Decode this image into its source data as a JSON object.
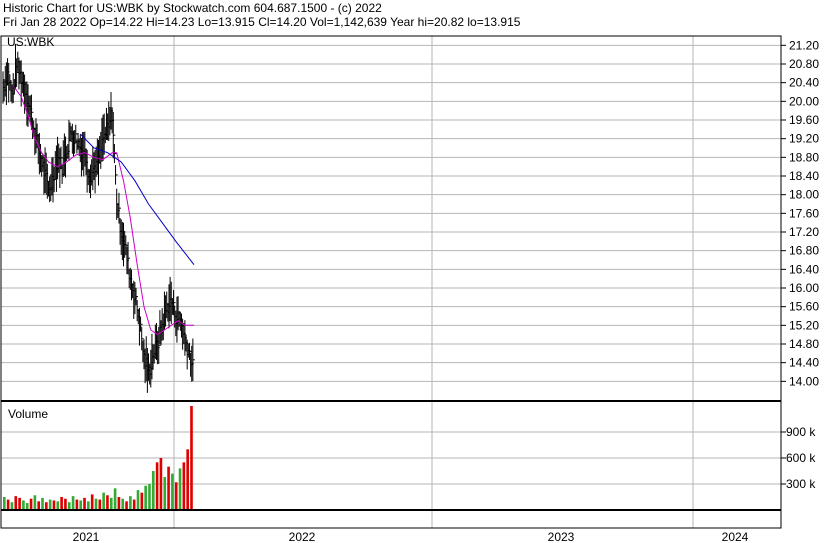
{
  "header": {
    "line1": "Historic Chart for US:WBK by Stockwatch.com 604.687.1500 - (c) 2022",
    "line2": "Fri Jan 28 2022   Op=14.22   Hi=14.23   Lo=13.915   Cl=14.20   Vol=1,142,639   Year hi=20.82   lo=13.915"
  },
  "colors": {
    "ma_fast": "#cc00cc",
    "ma_slow": "#0000cc",
    "vol_up": "#33aa33",
    "vol_down": "#dd0000",
    "grid": "#b4b4b4",
    "bars": "#000000"
  },
  "chart_data": [
    {
      "type": "ohlc-line",
      "label": "US:WBK",
      "ylim": [
        13.6,
        21.4
      ],
      "ytick_labels": [
        "21.20",
        "20.80",
        "20.40",
        "20.00",
        "19.60",
        "19.20",
        "18.80",
        "18.40",
        "18.00",
        "17.60",
        "17.20",
        "16.80",
        "16.40",
        "16.00",
        "15.60",
        "15.20",
        "14.80",
        "14.40",
        "14.00"
      ],
      "ytick_values": [
        21.2,
        20.8,
        20.4,
        20.0,
        19.6,
        19.2,
        18.8,
        18.4,
        18.0,
        17.6,
        17.2,
        16.8,
        16.4,
        16.0,
        15.6,
        15.2,
        14.8,
        14.4,
        14.0
      ],
      "xtick_labels": [
        "2021",
        "2022",
        "2023",
        "2024"
      ],
      "price_points": [
        {
          "x": 0.0,
          "y": 20.3
        },
        {
          "x": 0.02,
          "y": 20.6
        },
        {
          "x": 0.04,
          "y": 20.1
        },
        {
          "x": 0.06,
          "y": 20.75
        },
        {
          "x": 0.08,
          "y": 20.5
        },
        {
          "x": 0.1,
          "y": 20.2
        },
        {
          "x": 0.12,
          "y": 19.8
        },
        {
          "x": 0.14,
          "y": 19.3
        },
        {
          "x": 0.16,
          "y": 18.9
        },
        {
          "x": 0.18,
          "y": 18.5
        },
        {
          "x": 0.2,
          "y": 18.1
        },
        {
          "x": 0.22,
          "y": 18.4
        },
        {
          "x": 0.24,
          "y": 18.8
        },
        {
          "x": 0.26,
          "y": 18.6
        },
        {
          "x": 0.28,
          "y": 19.0
        },
        {
          "x": 0.3,
          "y": 19.3
        },
        {
          "x": 0.32,
          "y": 19.2
        },
        {
          "x": 0.34,
          "y": 19.0
        },
        {
          "x": 0.36,
          "y": 18.9
        },
        {
          "x": 0.38,
          "y": 18.4
        },
        {
          "x": 0.4,
          "y": 18.6
        },
        {
          "x": 0.42,
          "y": 18.7
        },
        {
          "x": 0.44,
          "y": 19.2
        },
        {
          "x": 0.46,
          "y": 19.4
        },
        {
          "x": 0.48,
          "y": 19.75
        },
        {
          "x": 0.5,
          "y": 17.9
        },
        {
          "x": 0.52,
          "y": 17.2
        },
        {
          "x": 0.54,
          "y": 16.8
        },
        {
          "x": 0.56,
          "y": 16.2
        },
        {
          "x": 0.58,
          "y": 15.8
        },
        {
          "x": 0.6,
          "y": 15.3
        },
        {
          "x": 0.62,
          "y": 14.5
        },
        {
          "x": 0.64,
          "y": 14.2
        },
        {
          "x": 0.66,
          "y": 14.6
        },
        {
          "x": 0.68,
          "y": 14.8
        },
        {
          "x": 0.7,
          "y": 15.2
        },
        {
          "x": 0.72,
          "y": 15.6
        },
        {
          "x": 0.74,
          "y": 15.7
        },
        {
          "x": 0.76,
          "y": 15.4
        },
        {
          "x": 0.78,
          "y": 15.3
        },
        {
          "x": 0.8,
          "y": 14.9
        },
        {
          "x": 0.82,
          "y": 14.6
        },
        {
          "x": 0.84,
          "y": 14.2
        }
      ],
      "ma_fast": [
        {
          "x": 0.05,
          "y": 20.3
        },
        {
          "x": 0.08,
          "y": 20.1
        },
        {
          "x": 0.11,
          "y": 19.7
        },
        {
          "x": 0.14,
          "y": 19.2
        },
        {
          "x": 0.17,
          "y": 18.9
        },
        {
          "x": 0.2,
          "y": 18.7
        },
        {
          "x": 0.24,
          "y": 18.6
        },
        {
          "x": 0.28,
          "y": 18.7
        },
        {
          "x": 0.32,
          "y": 18.85
        },
        {
          "x": 0.36,
          "y": 18.9
        },
        {
          "x": 0.4,
          "y": 18.8
        },
        {
          "x": 0.44,
          "y": 18.75
        },
        {
          "x": 0.48,
          "y": 18.9
        },
        {
          "x": 0.5,
          "y": 18.9
        },
        {
          "x": 0.53,
          "y": 18.3
        },
        {
          "x": 0.56,
          "y": 17.5
        },
        {
          "x": 0.59,
          "y": 16.5
        },
        {
          "x": 0.62,
          "y": 15.6
        },
        {
          "x": 0.65,
          "y": 15.1
        },
        {
          "x": 0.68,
          "y": 15.0
        },
        {
          "x": 0.71,
          "y": 15.1
        },
        {
          "x": 0.74,
          "y": 15.2
        },
        {
          "x": 0.77,
          "y": 15.3
        },
        {
          "x": 0.8,
          "y": 15.2
        },
        {
          "x": 0.84,
          "y": 15.2
        }
      ],
      "ma_slow": [
        {
          "x": 0.34,
          "y": 19.3
        },
        {
          "x": 0.4,
          "y": 19.0
        },
        {
          "x": 0.46,
          "y": 18.9
        },
        {
          "x": 0.52,
          "y": 18.7
        },
        {
          "x": 0.58,
          "y": 18.3
        },
        {
          "x": 0.64,
          "y": 17.8
        },
        {
          "x": 0.7,
          "y": 17.4
        },
        {
          "x": 0.76,
          "y": 17.0
        },
        {
          "x": 0.84,
          "y": 16.5
        }
      ]
    },
    {
      "type": "bar",
      "label": "Volume",
      "ylim": [
        0,
        1200000
      ],
      "ytick_labels": [
        "900 k",
        "600 k",
        "300 k"
      ],
      "ytick_values": [
        900000,
        600000,
        300000
      ],
      "values": [
        150000,
        120000,
        90000,
        160000,
        140000,
        110000,
        80000,
        130000,
        170000,
        100000,
        140000,
        90000,
        120000,
        110000,
        100000,
        150000,
        130000,
        90000,
        160000,
        120000,
        110000,
        140000,
        100000,
        180000,
        130000,
        120000,
        200000,
        170000,
        140000,
        250000,
        150000,
        130000,
        100000,
        160000,
        120000,
        230000,
        200000,
        280000,
        300000,
        450000,
        550000,
        600000,
        380000,
        500000,
        420000,
        320000,
        480000,
        550000,
        700000,
        1200000
      ],
      "up": [
        1,
        0,
        1,
        0,
        0,
        1,
        1,
        0,
        1,
        0,
        1,
        0,
        1,
        0,
        1,
        0,
        0,
        1,
        1,
        0,
        1,
        0,
        1,
        0,
        1,
        0,
        1,
        0,
        1,
        1,
        0,
        1,
        0,
        1,
        0,
        1,
        0,
        1,
        1,
        1,
        0,
        0,
        1,
        0,
        1,
        0,
        1,
        0,
        0,
        0
      ]
    }
  ]
}
